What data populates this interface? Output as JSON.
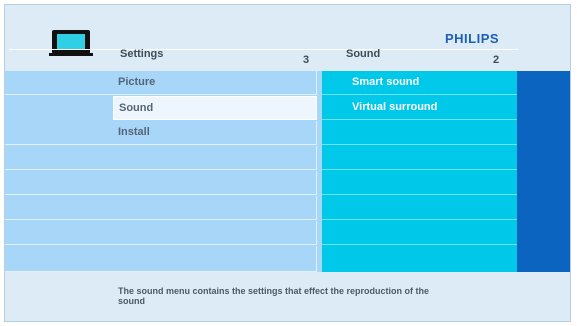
{
  "brand": "PHILIPS",
  "header": {
    "left_title": "Settings",
    "left_count": "3",
    "right_title": "Sound",
    "right_count": "2"
  },
  "menu": {
    "items": [
      {
        "label": "Picture"
      },
      {
        "label": "Sound",
        "selected": true
      },
      {
        "label": "Install"
      }
    ]
  },
  "submenu": {
    "items": [
      {
        "label": "Smart sound"
      },
      {
        "label": "Virtual surround"
      }
    ]
  },
  "footer": {
    "help_text": "The sound menu contains the settings that effect the reproduction of the sound"
  },
  "colors": {
    "menu_bg": "#a8d6f8",
    "submenu_bg": "#00c8e8",
    "right_panel": "#0a64c0",
    "brand": "#1d5fb4"
  },
  "icons": {
    "header_icon": "tv-icon"
  }
}
